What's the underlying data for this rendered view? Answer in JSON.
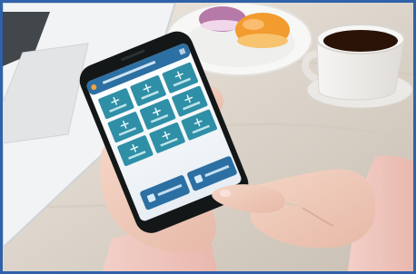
{
  "scene": {
    "photo_border_color": "#2f62a8",
    "app_accent_color": "#2f8fa6",
    "header_color": "#2c6fa3",
    "bottom_button_color": "#2c6fa3"
  },
  "phone_app": {
    "header_title": "",
    "grid_tiles": [
      {
        "icon": "tile-icon-1"
      },
      {
        "icon": "tile-icon-2"
      },
      {
        "icon": "tile-icon-3"
      },
      {
        "icon": "tile-icon-4"
      },
      {
        "icon": "tile-icon-5"
      },
      {
        "icon": "tile-icon-6"
      },
      {
        "icon": "tile-icon-7"
      },
      {
        "icon": "tile-icon-8"
      },
      {
        "icon": "tile-icon-9"
      }
    ],
    "bottom_buttons": [
      {
        "icon": "bottom-left-icon"
      },
      {
        "icon": "bottom-right-icon"
      }
    ]
  }
}
